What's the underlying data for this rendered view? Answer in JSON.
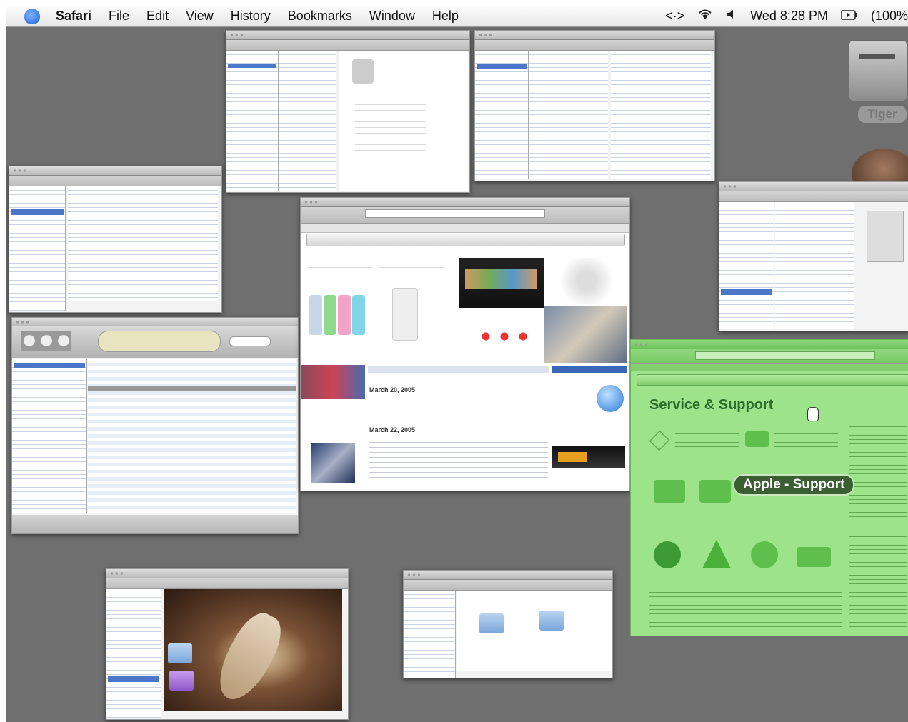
{
  "menubar": {
    "app_name": "Safari",
    "items": [
      "File",
      "Edit",
      "View",
      "History",
      "Bookmarks",
      "Window",
      "Help"
    ],
    "status": {
      "script_glyph": "<·>",
      "wifi_icon": "wifi-icon",
      "volume_icon": "volume-icon",
      "clock": "Wed 8:28 PM",
      "battery": "(100%"
    }
  },
  "desktop": {
    "drive_label": "Tiger"
  },
  "support_window": {
    "heading": "Service & Support"
  },
  "expose_tooltip": "Apple - Support",
  "apple_window": {
    "news_heading": "March 20, 2005",
    "news_heading_2": "March 22, 2005"
  },
  "colors": {
    "desktop": "#6f6f6f",
    "highlight_green": "#9de38a",
    "tooltip_bg": "#3c5e33"
  }
}
